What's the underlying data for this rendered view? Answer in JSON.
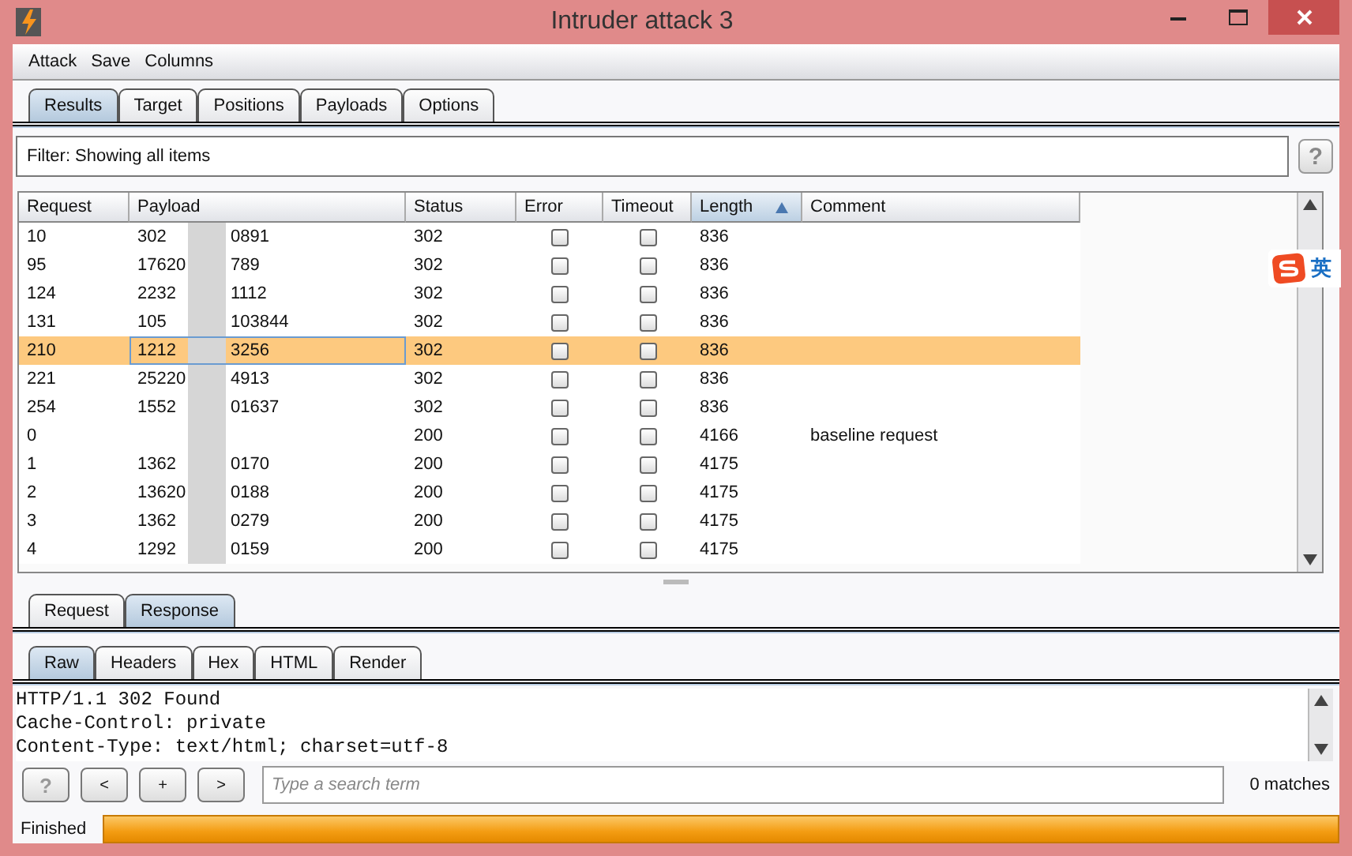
{
  "window": {
    "title": "Intruder attack 3"
  },
  "menu": [
    "Attack",
    "Save",
    "Columns"
  ],
  "tabs": [
    {
      "label": "Results",
      "selected": true
    },
    {
      "label": "Target",
      "selected": false
    },
    {
      "label": "Positions",
      "selected": false
    },
    {
      "label": "Payloads",
      "selected": false
    },
    {
      "label": "Options",
      "selected": false
    }
  ],
  "filter": {
    "text": "Filter:  Showing all items",
    "help": "?"
  },
  "table": {
    "columns": [
      {
        "label": "Request",
        "sorted": false
      },
      {
        "label": "Payload",
        "sorted": false
      },
      {
        "label": "Status",
        "sorted": false
      },
      {
        "label": "Error",
        "sorted": false
      },
      {
        "label": "Timeout",
        "sorted": false
      },
      {
        "label": "Length",
        "sorted": true
      },
      {
        "label": "Comment",
        "sorted": false
      }
    ],
    "rows": [
      {
        "request": "10",
        "payload_head": "302",
        "payload_tail": "0891",
        "status": "302",
        "error": false,
        "timeout": false,
        "length": "836",
        "comment": "",
        "selected": false
      },
      {
        "request": "95",
        "payload_head": "17620",
        "payload_tail": "789",
        "status": "302",
        "error": false,
        "timeout": false,
        "length": "836",
        "comment": "",
        "selected": false
      },
      {
        "request": "124",
        "payload_head": "2232",
        "payload_tail": "1112",
        "status": "302",
        "error": false,
        "timeout": false,
        "length": "836",
        "comment": "",
        "selected": false
      },
      {
        "request": "131",
        "payload_head": "105",
        "payload_tail": "103844",
        "status": "302",
        "error": false,
        "timeout": false,
        "length": "836",
        "comment": "",
        "selected": false
      },
      {
        "request": "210",
        "payload_head": "1212",
        "payload_tail": "3256",
        "status": "302",
        "error": false,
        "timeout": false,
        "length": "836",
        "comment": "",
        "selected": true
      },
      {
        "request": "221",
        "payload_head": "25220",
        "payload_tail": "4913",
        "status": "302",
        "error": false,
        "timeout": false,
        "length": "836",
        "comment": "",
        "selected": false
      },
      {
        "request": "254",
        "payload_head": "1552",
        "payload_tail": "01637",
        "status": "302",
        "error": false,
        "timeout": false,
        "length": "836",
        "comment": "",
        "selected": false
      },
      {
        "request": "0",
        "payload_head": "",
        "payload_tail": "",
        "status": "200",
        "error": false,
        "timeout": false,
        "length": "4166",
        "comment": "baseline request",
        "selected": false
      },
      {
        "request": "1",
        "payload_head": "1362",
        "payload_tail": "0170",
        "status": "200",
        "error": false,
        "timeout": false,
        "length": "4175",
        "comment": "",
        "selected": false
      },
      {
        "request": "2",
        "payload_head": "13620",
        "payload_tail": "0188",
        "status": "200",
        "error": false,
        "timeout": false,
        "length": "4175",
        "comment": "",
        "selected": false
      },
      {
        "request": "3",
        "payload_head": "1362",
        "payload_tail": "0279",
        "status": "200",
        "error": false,
        "timeout": false,
        "length": "4175",
        "comment": "",
        "selected": false
      },
      {
        "request": "4",
        "payload_head": "1292",
        "payload_tail": "0159",
        "status": "200",
        "error": false,
        "timeout": false,
        "length": "4175",
        "comment": "",
        "selected": false
      }
    ]
  },
  "message_tabs": [
    {
      "label": "Request",
      "selected": false
    },
    {
      "label": "Response",
      "selected": true
    }
  ],
  "view_tabs": [
    {
      "label": "Raw",
      "selected": true
    },
    {
      "label": "Headers",
      "selected": false
    },
    {
      "label": "Hex",
      "selected": false
    },
    {
      "label": "HTML",
      "selected": false
    },
    {
      "label": "Render",
      "selected": false
    }
  ],
  "response_lines": [
    "HTTP/1.1 302 Found",
    "Cache-Control: private",
    "Content-Type: text/html; charset=utf-8"
  ],
  "search": {
    "buttons": [
      "?",
      "<",
      "+",
      ">"
    ],
    "placeholder": "Type a search term",
    "matches": "0 matches"
  },
  "status": {
    "text": "Finished",
    "level": 1
  },
  "ime": {
    "label": "英"
  }
}
